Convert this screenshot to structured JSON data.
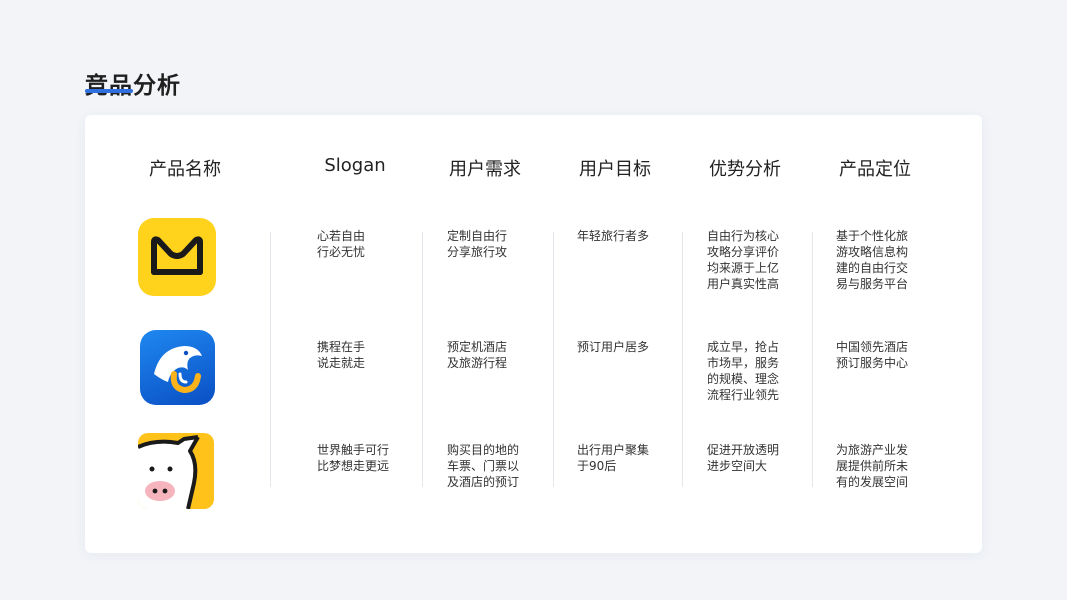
{
  "page": {
    "title": "竞品分析"
  },
  "table": {
    "headers": [
      "产品名称",
      "Slogan",
      "用户需求",
      "用户目标",
      "优势分析",
      "产品定位"
    ],
    "rows": [
      {
        "icon": "qunar-app-icon",
        "slogan": "心若自由\n行必无忧",
        "need": "定制自由行\n分享旅行攻",
        "goal": "年轻旅行者多",
        "advantage": "自由行为核心\n攻略分享评价\n均来源于上亿\n用户真实性高",
        "positioning": "基于个性化旅\n游攻略信息构\n建的自由行交\n易与服务平台"
      },
      {
        "icon": "ctrip-app-icon",
        "slogan": "携程在手\n说走就走",
        "need": "预定机酒店\n及旅游行程",
        "goal": "预订用户居多",
        "advantage": "成立早，抢占\n市场早，服务\n的规模、理念\n流程行业领先",
        "positioning": "中国领先酒店\n预订服务中心"
      },
      {
        "icon": "fliggy-app-icon",
        "slogan": "世界触手可行\n比梦想走更远",
        "need": "购买目的地的\n车票、门票以\n及酒店的预订",
        "goal": "出行用户聚集\n于90后",
        "advantage": "促进开放透明\n进步空间大",
        "positioning": "为旅游产业发\n展提供前所未\n有的发展空间"
      }
    ]
  },
  "colors": {
    "background": "#f2f4f8",
    "card": "#ffffff",
    "accent": "#2f6fe0",
    "qunar_yellow": "#ffd21c",
    "ctrip_blue": "#1266d8",
    "fliggy_yellow": "#ffc21a"
  }
}
